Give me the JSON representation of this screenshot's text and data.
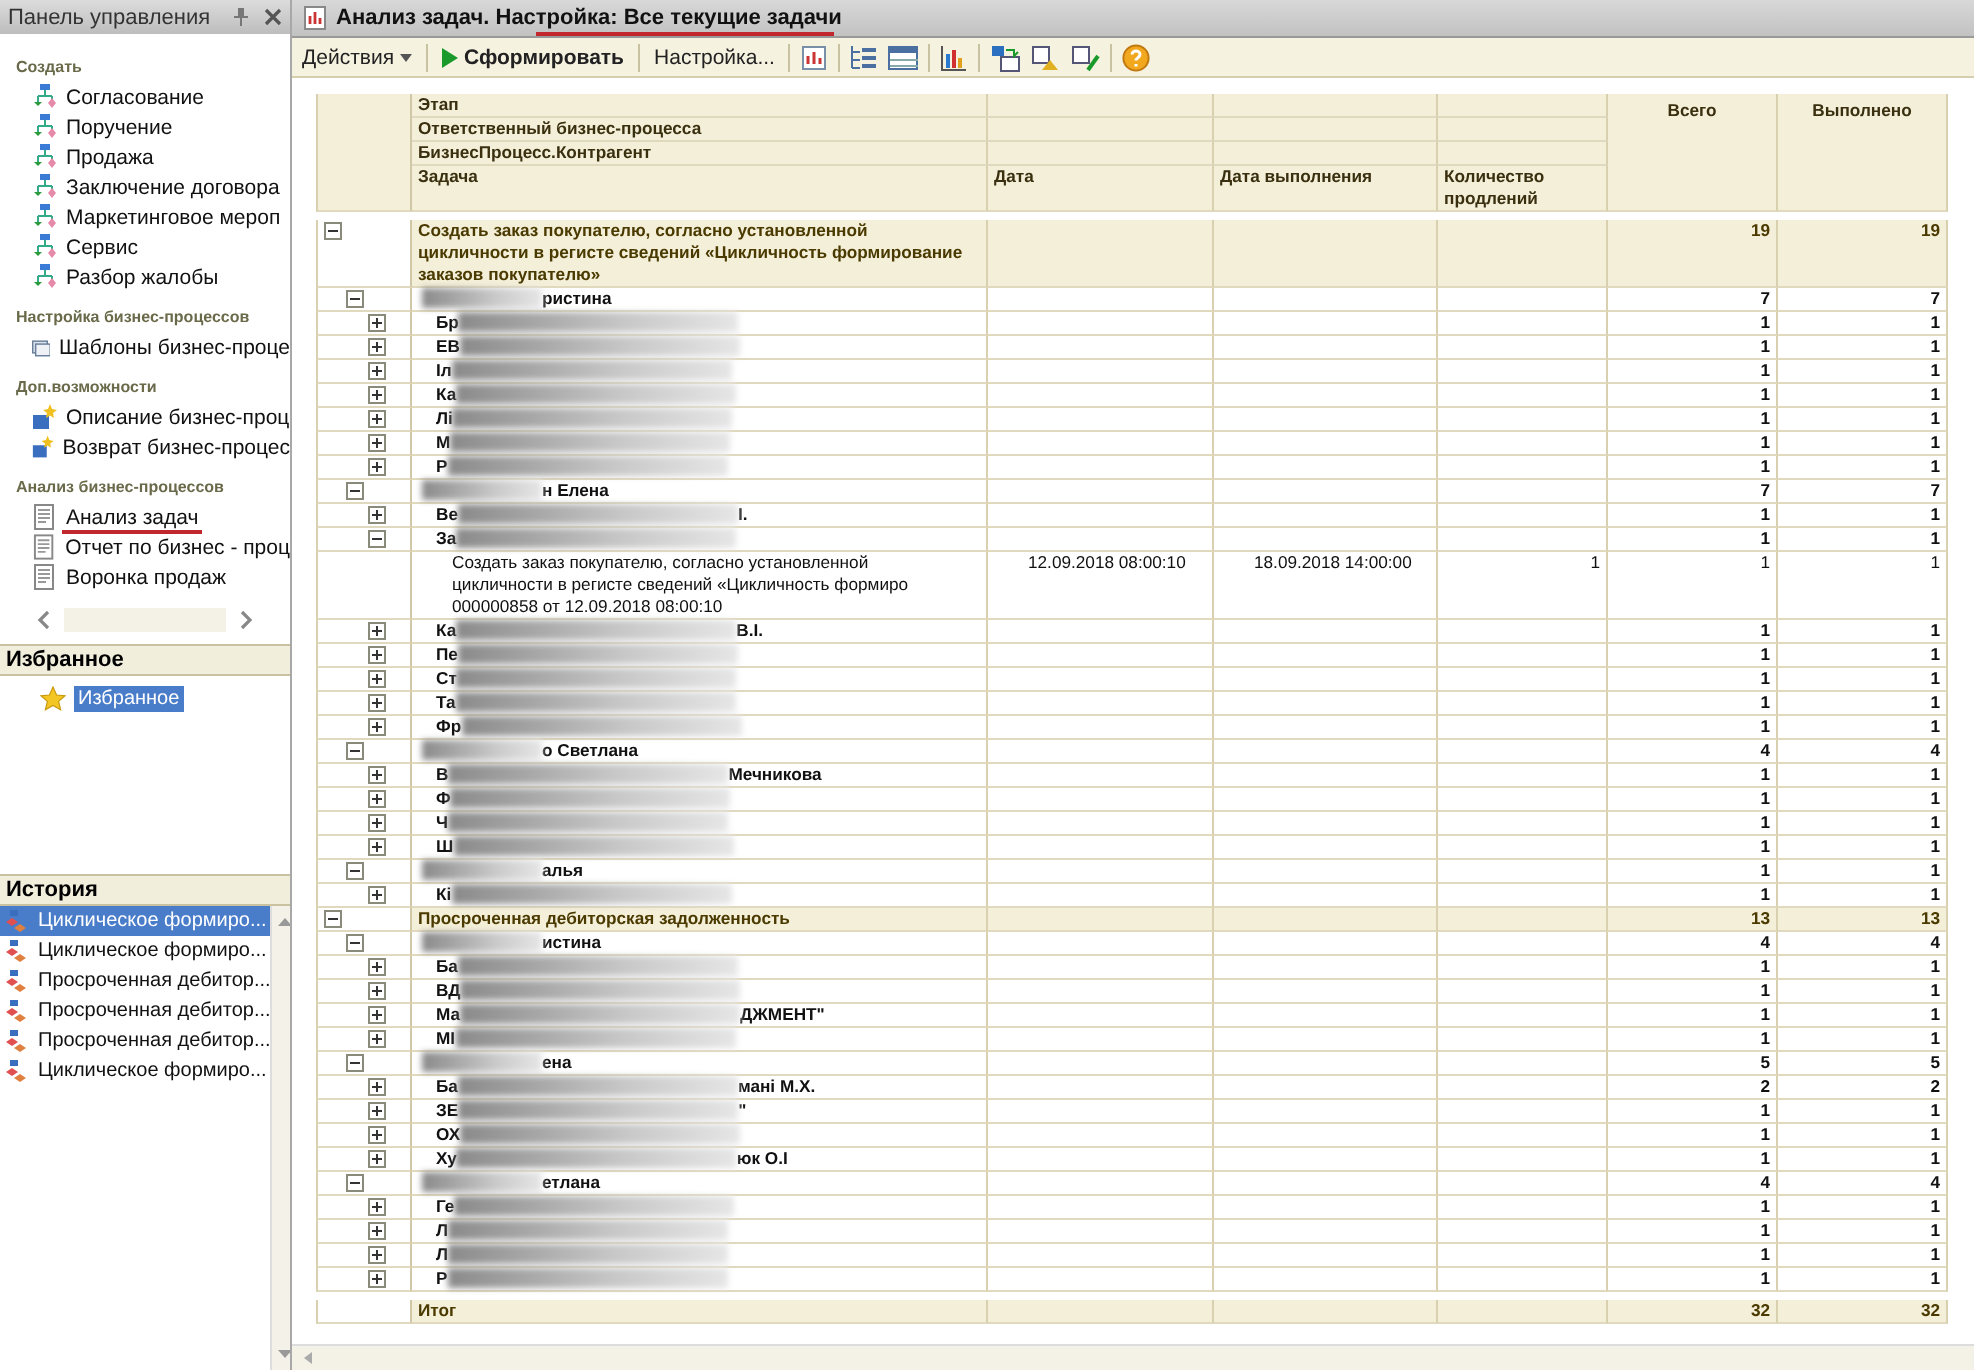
{
  "panel": {
    "title": "Панель управления",
    "sections": [
      {
        "heading": "Создать",
        "items": [
          {
            "label": "Согласование",
            "kind": "process"
          },
          {
            "label": "Поручение",
            "kind": "process"
          },
          {
            "label": "Продажа",
            "kind": "process"
          },
          {
            "label": "Заключение договора",
            "kind": "process"
          },
          {
            "label": "Маркетинговое мероп",
            "kind": "process"
          },
          {
            "label": "Сервис",
            "kind": "process"
          },
          {
            "label": "Разбор жалобы",
            "kind": "process"
          }
        ]
      },
      {
        "heading": "Настройка бизнес-процессов",
        "items": [
          {
            "label": "Шаблоны бизнес-проце",
            "kind": "template"
          }
        ]
      },
      {
        "heading": "Доп.возможности",
        "items": [
          {
            "label": "Описание бизнес-проц",
            "kind": "extra"
          },
          {
            "label": "Возврат бизнес-процес",
            "kind": "extra"
          }
        ]
      },
      {
        "heading": "Анализ бизнес-процессов",
        "items": [
          {
            "label": "Анализ задач",
            "kind": "report"
          },
          {
            "label": "Отчет по бизнес - проц",
            "kind": "report"
          },
          {
            "label": "Воронка продаж",
            "kind": "report"
          }
        ]
      }
    ]
  },
  "favorites": {
    "heading": "Избранное",
    "items": [
      {
        "label": "Избранное",
        "selected": true
      }
    ]
  },
  "history": {
    "heading": "История",
    "items": [
      {
        "label": "Циклическое формиро...",
        "selected": true
      },
      {
        "label": "Циклическое формиро...",
        "selected": false
      },
      {
        "label": "Просроченная дебитор...",
        "selected": false
      },
      {
        "label": "Просроченная дебитор...",
        "selected": false
      },
      {
        "label": "Просроченная дебитор...",
        "selected": false
      },
      {
        "label": "Циклическое формиро...",
        "selected": false
      }
    ]
  },
  "window": {
    "title": "Анализ задач. Настройка: Все текущие задачи"
  },
  "toolbar": {
    "actions": "Действия",
    "generate": "Сформировать",
    "settings": "Настройка..."
  },
  "table": {
    "header": {
      "levels": [
        "Этап",
        "Ответственный бизнес-процесса",
        "БизнесПроцесс.Контрагент",
        "Задача"
      ],
      "columns": [
        "Дата",
        "Дата выполнения",
        "Количество продлений",
        "Всего",
        "Выполнено"
      ]
    },
    "groups": [
      {
        "text": "Создать заказ покупателю, согласно установленной цикличности в регисте сведений «Цикличность формирование заказов покупателю»",
        "total": "19",
        "done": "19",
        "expanded": true,
        "children": [
          {
            "redacted": true,
            "suffix": "ристина",
            "total": "7",
            "done": "7",
            "expanded": true,
            "children": [
              {
                "text": "Бр",
                "redacted": true,
                "total": "1",
                "done": "1",
                "expanded": false
              },
              {
                "text": "ЕВ",
                "redacted": true,
                "total": "1",
                "done": "1",
                "expanded": false
              },
              {
                "text": "Іл",
                "redacted": true,
                "total": "1",
                "done": "1",
                "expanded": false
              },
              {
                "text": "Ка",
                "redacted": true,
                "total": "1",
                "done": "1",
                "expanded": false
              },
              {
                "text": "Лі",
                "redacted": true,
                "total": "1",
                "done": "1",
                "expanded": false
              },
              {
                "text": "М",
                "redacted": true,
                "total": "1",
                "done": "1",
                "expanded": false
              },
              {
                "text": "Р",
                "redacted": true,
                "total": "1",
                "done": "1",
                "expanded": false
              }
            ]
          },
          {
            "redacted": true,
            "suffix": "н Елена",
            "total": "7",
            "done": "7",
            "expanded": true,
            "children": [
              {
                "text": "Ве",
                "redacted": true,
                "suffix": "І.",
                "total": "1",
                "done": "1",
                "expanded": false
              },
              {
                "text": "За",
                "redacted": true,
                "total": "1",
                "done": "1",
                "expanded": true,
                "children": [
                  {
                    "kind": "task",
                    "lines": [
                      "Создать заказ покупателю, согласно установленной",
                      "цикличности в регисте сведений «Цикличность формиро",
                      "000000858 от 12.09.2018 08:00:10"
                    ],
                    "date": "12.09.2018 08:00:10",
                    "due": "18.09.2018 14:00:00",
                    "extensions": "1",
                    "total": "1",
                    "done": "1"
                  }
                ]
              },
              {
                "text": "Ка",
                "redacted": true,
                "suffix": "В.І.",
                "total": "1",
                "done": "1",
                "expanded": false
              },
              {
                "text": "Пе",
                "redacted": true,
                "total": "1",
                "done": "1",
                "expanded": false
              },
              {
                "text": "Ст",
                "redacted": true,
                "total": "1",
                "done": "1",
                "expanded": false
              },
              {
                "text": "Та",
                "redacted": true,
                "total": "1",
                "done": "1",
                "expanded": false
              },
              {
                "text": "Фр",
                "redacted": true,
                "total": "1",
                "done": "1",
                "expanded": false
              }
            ]
          },
          {
            "redacted": true,
            "suffix": "о Светлана",
            "total": "4",
            "done": "4",
            "expanded": true,
            "children": [
              {
                "text": "В",
                "redacted": true,
                "suffix": "Мечникова",
                "total": "1",
                "done": "1",
                "expanded": false
              },
              {
                "text": "Ф",
                "redacted": true,
                "total": "1",
                "done": "1",
                "expanded": false
              },
              {
                "text": "Ч",
                "redacted": true,
                "total": "1",
                "done": "1",
                "expanded": false
              },
              {
                "text": "Ш",
                "redacted": true,
                "total": "1",
                "done": "1",
                "expanded": false
              }
            ]
          },
          {
            "redacted": true,
            "suffix": "алья",
            "total": "1",
            "done": "1",
            "expanded": true,
            "children": [
              {
                "text": "Кі",
                "redacted": true,
                "total": "1",
                "done": "1",
                "expanded": false
              }
            ]
          }
        ]
      },
      {
        "text": "Просроченная дебиторская задолженность",
        "total": "13",
        "done": "13",
        "expanded": true,
        "children": [
          {
            "redacted": true,
            "suffix": "истина",
            "total": "4",
            "done": "4",
            "expanded": true,
            "children": [
              {
                "text": "Ба",
                "redacted": true,
                "total": "1",
                "done": "1",
                "expanded": false
              },
              {
                "text": "ВД",
                "redacted": true,
                "total": "1",
                "done": "1",
                "expanded": false
              },
              {
                "text": "Ма",
                "redacted": true,
                "suffix": "ДЖМЕНТ\"",
                "total": "1",
                "done": "1",
                "expanded": false
              },
              {
                "text": "МІ",
                "redacted": true,
                "total": "1",
                "done": "1",
                "expanded": false
              }
            ]
          },
          {
            "redacted": true,
            "suffix": "ена",
            "total": "5",
            "done": "5",
            "expanded": true,
            "children": [
              {
                "text": "Ба",
                "redacted": true,
                "suffix": "мані М.Х.",
                "total": "2",
                "done": "2",
                "expanded": false
              },
              {
                "text": "ЗЕ",
                "redacted": true,
                "suffix": "\"",
                "total": "1",
                "done": "1",
                "expanded": false
              },
              {
                "text": "ОХ",
                "redacted": true,
                "total": "1",
                "done": "1",
                "expanded": false
              },
              {
                "text": "Ху",
                "redacted": true,
                "suffix": "юк О.І",
                "total": "1",
                "done": "1",
                "expanded": false
              }
            ]
          },
          {
            "redacted": true,
            "suffix": "етлана",
            "total": "4",
            "done": "4",
            "expanded": true,
            "children": [
              {
                "text": "Ге",
                "redacted": true,
                "total": "1",
                "done": "1",
                "expanded": false
              },
              {
                "text": "Л",
                "redacted": true,
                "total": "1",
                "done": "1",
                "expanded": false
              },
              {
                "text": "Л",
                "redacted": true,
                "total": "1",
                "done": "1",
                "expanded": false
              },
              {
                "text": "Р",
                "redacted": true,
                "total": "1",
                "done": "1",
                "expanded": false
              }
            ]
          }
        ]
      }
    ],
    "total": {
      "label": "Итог",
      "total": "32",
      "done": "32"
    }
  }
}
